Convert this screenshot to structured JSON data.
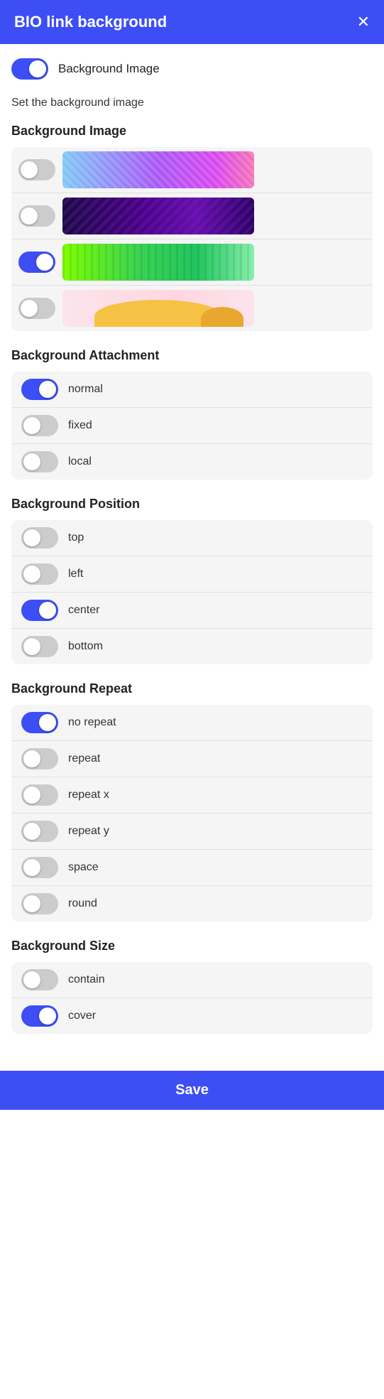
{
  "header": {
    "title": "BIO link background",
    "close_label": "✕"
  },
  "top_toggle": {
    "label": "Background Image",
    "state": "on"
  },
  "section_subtitle": "Set the background image",
  "background_image_section": {
    "heading": "Background Image",
    "images": [
      {
        "id": "img-1",
        "state": "off",
        "style_class": "img-1"
      },
      {
        "id": "img-2",
        "state": "off",
        "style_class": "img-2"
      },
      {
        "id": "img-3",
        "state": "on",
        "style_class": "img-3"
      },
      {
        "id": "img-4",
        "state": "off",
        "style_class": "img-4"
      }
    ]
  },
  "background_attachment": {
    "heading": "Background Attachment",
    "options": [
      {
        "label": "normal",
        "state": "on"
      },
      {
        "label": "fixed",
        "state": "off"
      },
      {
        "label": "local",
        "state": "off"
      }
    ]
  },
  "background_position": {
    "heading": "Background Position",
    "options": [
      {
        "label": "top",
        "state": "off"
      },
      {
        "label": "left",
        "state": "off"
      },
      {
        "label": "center",
        "state": "on"
      },
      {
        "label": "bottom",
        "state": "off"
      }
    ]
  },
  "background_repeat": {
    "heading": "Background Repeat",
    "options": [
      {
        "label": "no repeat",
        "state": "on"
      },
      {
        "label": "repeat",
        "state": "off"
      },
      {
        "label": "repeat x",
        "state": "off"
      },
      {
        "label": "repeat y",
        "state": "off"
      },
      {
        "label": "space",
        "state": "off"
      },
      {
        "label": "round",
        "state": "off"
      }
    ]
  },
  "background_size": {
    "heading": "Background Size",
    "options": [
      {
        "label": "contain",
        "state": "off"
      },
      {
        "label": "cover",
        "state": "on"
      }
    ]
  },
  "save_button": {
    "label": "Save"
  }
}
